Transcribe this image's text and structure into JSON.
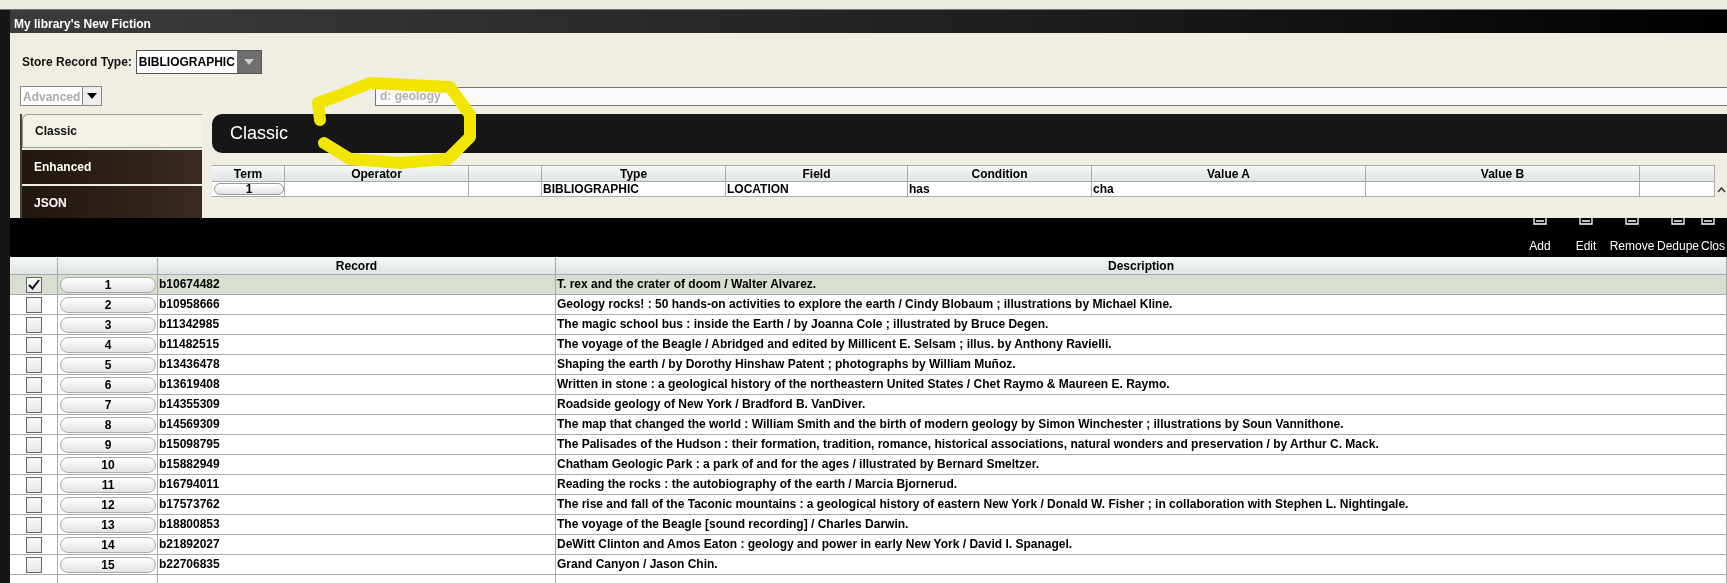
{
  "window": {
    "title": "My library's New Fiction"
  },
  "store_record_type": {
    "label": "Store Record Type:",
    "value": "BIBLIOGRAPHIC"
  },
  "mode_select": {
    "value": "Advanced",
    "disabled": true
  },
  "search": {
    "placeholder": "d: geology"
  },
  "side_tabs": [
    {
      "label": "Classic",
      "selected": true
    },
    {
      "label": "Enhanced",
      "selected": false
    },
    {
      "label": "JSON",
      "selected": false
    }
  ],
  "panel_title": "Classic",
  "term_table": {
    "columns": [
      "Term",
      "Operator",
      "Type",
      "Field",
      "Condition",
      "Value A",
      "Value B"
    ],
    "rows": [
      {
        "term": "1",
        "type": "BIBLIOGRAPHIC",
        "field": "LOCATION",
        "condition": "has",
        "value_a": "cha"
      }
    ]
  },
  "toolbar": [
    "Add",
    "Edit",
    "Remove",
    "Dedupe",
    "Clos"
  ],
  "records": {
    "columns": [
      "Record",
      "Description"
    ],
    "rows": [
      {
        "checked": true,
        "selected": true,
        "number": "1",
        "record": "b10674482",
        "description": "T. rex and the crater of doom / Walter Alvarez."
      },
      {
        "checked": false,
        "selected": false,
        "number": "2",
        "record": "b10958666",
        "description": "Geology rocks! : 50 hands-on activities to explore the earth / Cindy Blobaum ; illustrations by Michael Kline."
      },
      {
        "checked": false,
        "selected": false,
        "number": "3",
        "record": "b11342985",
        "description": "The magic school bus : inside the Earth / by Joanna Cole ; illustrated by Bruce Degen."
      },
      {
        "checked": false,
        "selected": false,
        "number": "4",
        "record": "b11482515",
        "description": "The voyage of the Beagle / Abridged and edited by Millicent E. Selsam ; illus. by Anthony Ravielli."
      },
      {
        "checked": false,
        "selected": false,
        "number": "5",
        "record": "b13436478",
        "description": "Shaping the earth / by Dorothy Hinshaw Patent ; photographs by William Muñoz."
      },
      {
        "checked": false,
        "selected": false,
        "number": "6",
        "record": "b13619408",
        "description": "Written in stone : a geological history of the northeastern United States / Chet Raymo & Maureen E. Raymo."
      },
      {
        "checked": false,
        "selected": false,
        "number": "7",
        "record": "b14355309",
        "description": "Roadside geology of New York / Bradford B. VanDiver."
      },
      {
        "checked": false,
        "selected": false,
        "number": "8",
        "record": "b14569309",
        "description": "The map that changed the world : William Smith and the birth of modern geology by Simon Winchester ; illustrations by Soun Vannithone."
      },
      {
        "checked": false,
        "selected": false,
        "number": "9",
        "record": "b15098795",
        "description": "The Palisades of the Hudson : their formation, tradition, romance, historical associations, natural wonders and preservation / by Arthur C. Mack."
      },
      {
        "checked": false,
        "selected": false,
        "number": "10",
        "record": "b15882949",
        "description": "Chatham Geologic Park : a park of and for the ages / illustrated by Bernard Smeltzer."
      },
      {
        "checked": false,
        "selected": false,
        "number": "11",
        "record": "b16794011",
        "description": "Reading the rocks : the autobiography of the earth / Marcia Bjornerud."
      },
      {
        "checked": false,
        "selected": false,
        "number": "12",
        "record": "b17573762",
        "description": "The rise and fall of the Taconic mountains : a geological history of eastern New York / Donald W. Fisher ; in collaboration with Stephen L. Nightingale."
      },
      {
        "checked": false,
        "selected": false,
        "number": "13",
        "record": "b18800853",
        "description": "The voyage of the Beagle [sound recording] / Charles Darwin."
      },
      {
        "checked": false,
        "selected": false,
        "number": "14",
        "record": "b21892027",
        "description": "DeWitt Clinton and Amos Eaton : geology and power in early New York / David I. Spanagel."
      },
      {
        "checked": false,
        "selected": false,
        "number": "15",
        "record": "b22706835",
        "description": "Grand Canyon / Jason Chin."
      }
    ]
  }
}
